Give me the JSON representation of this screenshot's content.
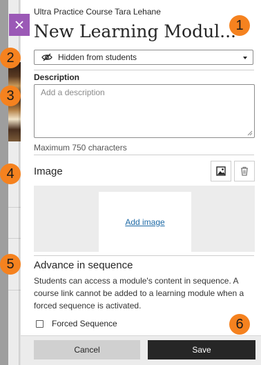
{
  "course": {
    "name": "Ultra Practice Course Tara Lehane"
  },
  "panel": {
    "title": "New Learning Modul..."
  },
  "visibility": {
    "selected": "Hidden from students",
    "icon": "eye-slash-icon"
  },
  "description": {
    "label": "Description",
    "placeholder": "Add a description",
    "hint": "Maximum 750 characters"
  },
  "image": {
    "heading": "Image",
    "add_link": "Add image",
    "icons": [
      "image-icon",
      "trash-icon"
    ]
  },
  "sequence": {
    "heading": "Advance in sequence",
    "description": "Students can access a module's content in sequence. A course link cannot be added to a learning module when a forced sequence is activated.",
    "checkbox_label": "Forced Sequence",
    "checked": false
  },
  "footer": {
    "cancel_label": "Cancel",
    "save_label": "Save"
  },
  "markers": [
    "1",
    "2",
    "3",
    "4",
    "5",
    "6"
  ],
  "colors": {
    "accent": "#9b59b6",
    "marker": "#f5821f",
    "save": "#262626",
    "link": "#1e6aa6"
  }
}
